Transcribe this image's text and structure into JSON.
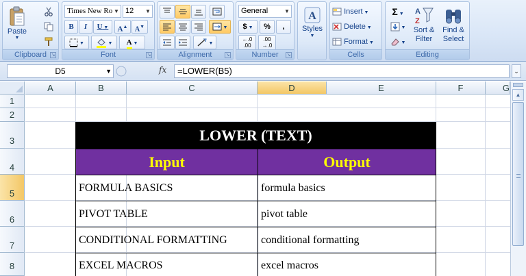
{
  "ribbon": {
    "clipboard": {
      "label": "Clipboard",
      "paste_label": "Paste"
    },
    "font": {
      "label": "Font",
      "font_name": "Times New Ro",
      "font_size": "12",
      "bold": "B",
      "italic": "I",
      "underline": "U",
      "grow": "A",
      "shrink": "A",
      "font_color": "A"
    },
    "alignment": {
      "label": "Alignment"
    },
    "number": {
      "label": "Number",
      "format": "General",
      "currency": "$",
      "percent": "%",
      "comma": ",",
      "inc_decimal": "←.0\n.00",
      "dec_decimal": ".00\n→.0"
    },
    "styles": {
      "label": "Styles"
    },
    "cells": {
      "label": "Cells",
      "insert": "Insert",
      "delete": "Delete",
      "format": "Format"
    },
    "editing": {
      "label": "Editing",
      "sort_filter": "Sort &\nFilter",
      "find_select": "Find &\nSelect",
      "sigma": "Σ"
    }
  },
  "formula_bar": {
    "name_box": "D5",
    "fx": "fx",
    "formula": "=LOWER(B5)"
  },
  "columns": [
    "A",
    "B",
    "C",
    "D",
    "E",
    "F",
    "G"
  ],
  "rows": [
    "1",
    "2",
    "3",
    "4",
    "5",
    "6",
    "7",
    "8"
  ],
  "table": {
    "title": "LOWER (TEXT)",
    "header_input": "Input",
    "header_output": "Output",
    "rows": [
      {
        "input": "FORMULA BASICS",
        "output": "formula basics"
      },
      {
        "input": "PIVOT TABLE",
        "output": "pivot table"
      },
      {
        "input": "CONDITIONAL FORMATTING",
        "output": "conditional formatting"
      },
      {
        "input": "EXCEL MACROS",
        "output": "excel macros"
      }
    ]
  },
  "colors": {
    "title_bg": "#000000",
    "title_text": "#ffffff",
    "header_bg": "#7030a0",
    "header_text": "#ffff00"
  }
}
